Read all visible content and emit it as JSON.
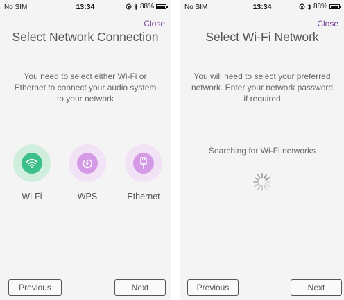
{
  "left": {
    "status": {
      "carrier": "No SIM",
      "time": "13:34",
      "battery": "88%",
      "battery_level": 0.88
    },
    "close_label": "Close",
    "title": "Select Network Connection",
    "description": "You need to select either Wi-Fi or Ethernet to connect your audio system to your network",
    "options": [
      {
        "label": "Wi-Fi",
        "icon": "wifi-icon",
        "color": "#3cbf8a",
        "halo": "#cfeedd"
      },
      {
        "label": "WPS",
        "icon": "wps-icon",
        "color": "#d59ae6",
        "halo": "#f2e2f6"
      },
      {
        "label": "Ethernet",
        "icon": "ethernet-plug-icon",
        "color": "#d59ae6",
        "halo": "#f2e2f6"
      }
    ],
    "previous_label": "Previous",
    "next_label": "Next"
  },
  "right": {
    "status": {
      "carrier": "No SIM",
      "time": "13:34",
      "battery": "88%",
      "battery_level": 0.88
    },
    "close_label": "Close",
    "title": "Select Wi-Fi Network",
    "description": "You will need to select your preferred network. Enter your network password if required",
    "searching_text": "Searching for Wi-Fi networks",
    "spinner_icon": "loading-spinner-icon",
    "previous_label": "Previous",
    "next_label": "Next"
  },
  "colors": {
    "accent": "#7a3f9a",
    "screen_bg": "#f4f4f4"
  }
}
